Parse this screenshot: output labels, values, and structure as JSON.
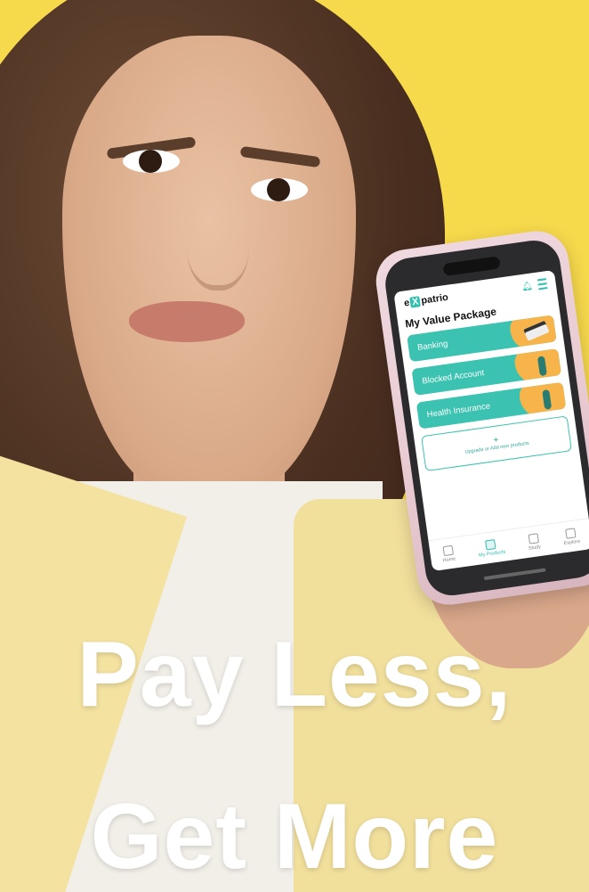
{
  "colors": {
    "background_yellow": "#f7d94c",
    "accent_teal": "#3cc2b0",
    "illustration_orange": "#f6b44a",
    "headline_white": "#ffffff"
  },
  "headline": {
    "line1": "Pay Less,",
    "line2": "Get More"
  },
  "app": {
    "logo": {
      "prefix": "e",
      "highlight": "X",
      "suffix": "patrio"
    },
    "header_icons": [
      "bell-icon",
      "menu-icon"
    ],
    "title": "My Value Package",
    "products": [
      {
        "label": "Banking",
        "icon": "bank-card-illustration"
      },
      {
        "label": "Blocked Account",
        "icon": "person-illustration"
      },
      {
        "label": "Health Insurance",
        "icon": "doctor-illustration"
      }
    ],
    "add_products": {
      "icon": "plus-icon",
      "label": "Upgrade or Add new products"
    },
    "tabs": [
      {
        "label": "Home",
        "icon": "home-grid-icon",
        "active": false
      },
      {
        "label": "My Products",
        "icon": "products-icon",
        "active": true
      },
      {
        "label": "Study",
        "icon": "study-icon",
        "active": false
      },
      {
        "label": "Explore",
        "icon": "explore-icon",
        "active": false
      }
    ]
  }
}
